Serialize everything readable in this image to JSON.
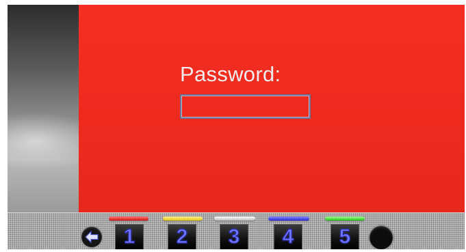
{
  "password_screen": {
    "label": "Password:",
    "value": "",
    "background_color": "#f02b20"
  },
  "toolbar": {
    "back_icon": "arrow-left-icon",
    "buttons": [
      {
        "label": "1",
        "color_bar": "#e32020"
      },
      {
        "label": "2",
        "color_bar": "#f0d21c"
      },
      {
        "label": "3",
        "color_bar": "#dcdcdc"
      },
      {
        "label": "4",
        "color_bar": "#3434e8"
      },
      {
        "label": "5",
        "color_bar": "#2fcf28"
      }
    ],
    "record_icon": "circle-icon"
  }
}
